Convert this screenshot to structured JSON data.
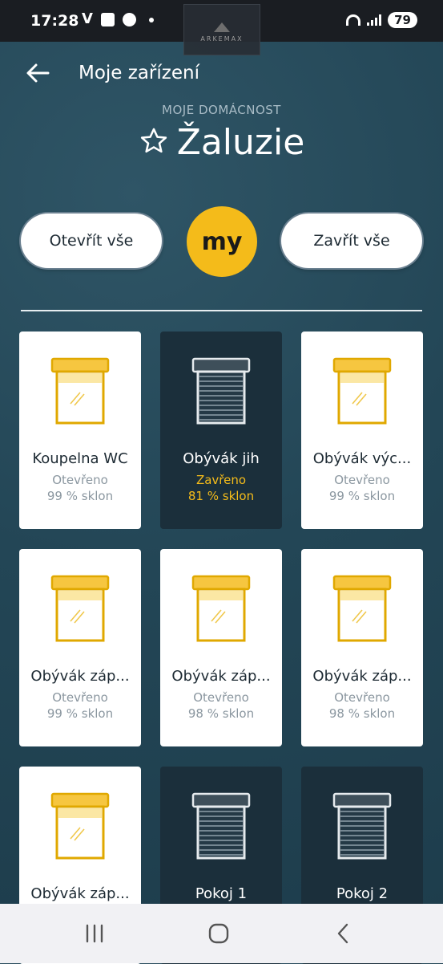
{
  "status_bar": {
    "time": "17:28",
    "battery": "79"
  },
  "watermark": {
    "text": "ARKEMAX"
  },
  "topbar": {
    "title": "Moje zařízení"
  },
  "header": {
    "subtitle": "MOJE DOMÁCNOST",
    "title": "Žaluzie"
  },
  "controls": {
    "open_all": "Otevřít vše",
    "my_label": "my",
    "close_all": "Zavřít vše"
  },
  "colors": {
    "accent": "#f4bb1a",
    "background": "#234656",
    "card_dark": "#1b2f3b"
  },
  "devices": [
    {
      "name": "Koupelna WC",
      "state": "Otevřeno",
      "tilt": "99 % sklon",
      "status": "open"
    },
    {
      "name": "Obývák jih",
      "state": "Zavřeno",
      "tilt": "81 % sklon",
      "status": "closed"
    },
    {
      "name": "Obývák výc...",
      "state": "Otevřeno",
      "tilt": "99 % sklon",
      "status": "open"
    },
    {
      "name": "Obývák záp...",
      "state": "Otevřeno",
      "tilt": "99 % sklon",
      "status": "open"
    },
    {
      "name": "Obývák záp...",
      "state": "Otevřeno",
      "tilt": "98 % sklon",
      "status": "open"
    },
    {
      "name": "Obývák záp...",
      "state": "Otevřeno",
      "tilt": "98 % sklon",
      "status": "open"
    },
    {
      "name": "Obývák záp...",
      "state": "",
      "tilt": "",
      "status": "open"
    },
    {
      "name": "Pokoj 1",
      "state": "",
      "tilt": "",
      "status": "closed"
    },
    {
      "name": "Pokoj 2",
      "state": "",
      "tilt": "",
      "status": "closed"
    }
  ],
  "icons": {
    "back": "arrow-left-icon",
    "favorite": "star-outline-icon",
    "recents": "recents-icon",
    "home": "home-icon",
    "nav_back": "chevron-left-icon"
  }
}
